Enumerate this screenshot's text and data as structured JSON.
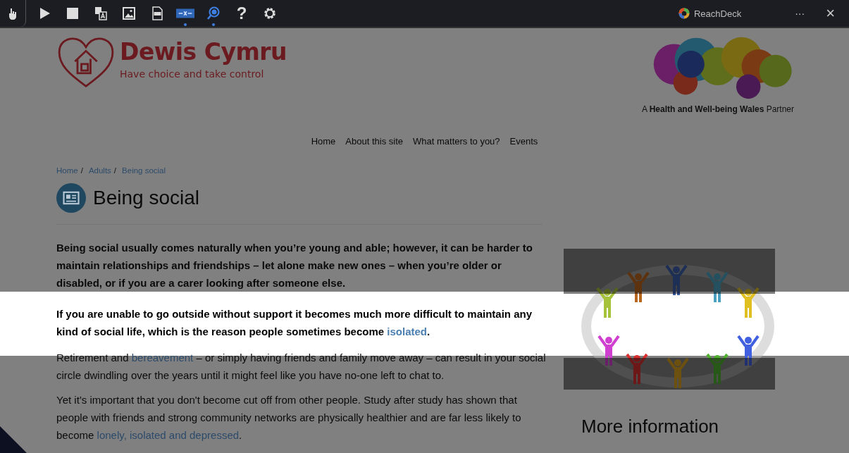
{
  "toolbar": {
    "tools": [
      {
        "kind": "drag",
        "on": false
      },
      {
        "kind": "play",
        "on": false
      },
      {
        "kind": "stop",
        "on": false
      },
      {
        "kind": "translate",
        "on": false
      },
      {
        "kind": "picture",
        "on": false
      },
      {
        "kind": "mp3",
        "on": false
      },
      {
        "kind": "mask",
        "on": true
      },
      {
        "kind": "magnifier",
        "on": true
      },
      {
        "kind": "help",
        "label": "?",
        "on": false
      },
      {
        "kind": "settings",
        "on": false
      }
    ],
    "brand": "ReachDeck",
    "more": "···",
    "close": "×"
  },
  "header": {
    "site_name": "Dewis Cymru",
    "tagline": "Have choice and take control",
    "partner": "A **Health and Well-being Wales** Partner"
  },
  "nav": [
    "Home",
    "About this site",
    "What matters to you?",
    "Events"
  ],
  "breadcrumb": [
    {
      "label": "Home",
      "separator": "/"
    },
    {
      "label": "Adults",
      "separator": "/"
    },
    {
      "label": "Being social"
    }
  ],
  "page_title": "Being social",
  "paragraphs": [
    {
      "bold": true,
      "in_focus": false,
      "segments": [
        {
          "text": "Being social usually comes naturally when you’re young and able; however, it can be harder to maintain relationships and friendships – let alone make new ones – when you’re older or disabled, or if you are a carer looking after someone else.",
          "link": false
        }
      ]
    },
    {
      "bold": true,
      "in_focus": true,
      "segments": [
        {
          "text": "If you are unable to go outside without support it becomes much more difficult to maintain any kind of social life, which is the reason people sometimes become ",
          "link": false
        },
        {
          "text": "isolated",
          "link": true
        },
        {
          "text": ".",
          "link": false
        }
      ]
    },
    {
      "bold": false,
      "in_focus": false,
      "segments": [
        {
          "text": "Retirement and ",
          "link": false
        },
        {
          "text": "bereavement",
          "link": true
        },
        {
          "text": " – or simply having friends and family move away – can result in your social circle dwindling over the years until it might feel like you have no-one left to chat to.",
          "link": false
        }
      ]
    },
    {
      "bold": false,
      "in_focus": false,
      "segments": [
        {
          "text": "Yet it’s important that you don't become cut off from other people. Study after study has shown that people with friends and strong community networks are physically healthier and are far less likely to become ",
          "link": false
        },
        {
          "text": "lonely, isolated and depressed",
          "link": true
        },
        {
          "text": ".",
          "link": false
        }
      ]
    }
  ],
  "aside_heading": "More information"
}
